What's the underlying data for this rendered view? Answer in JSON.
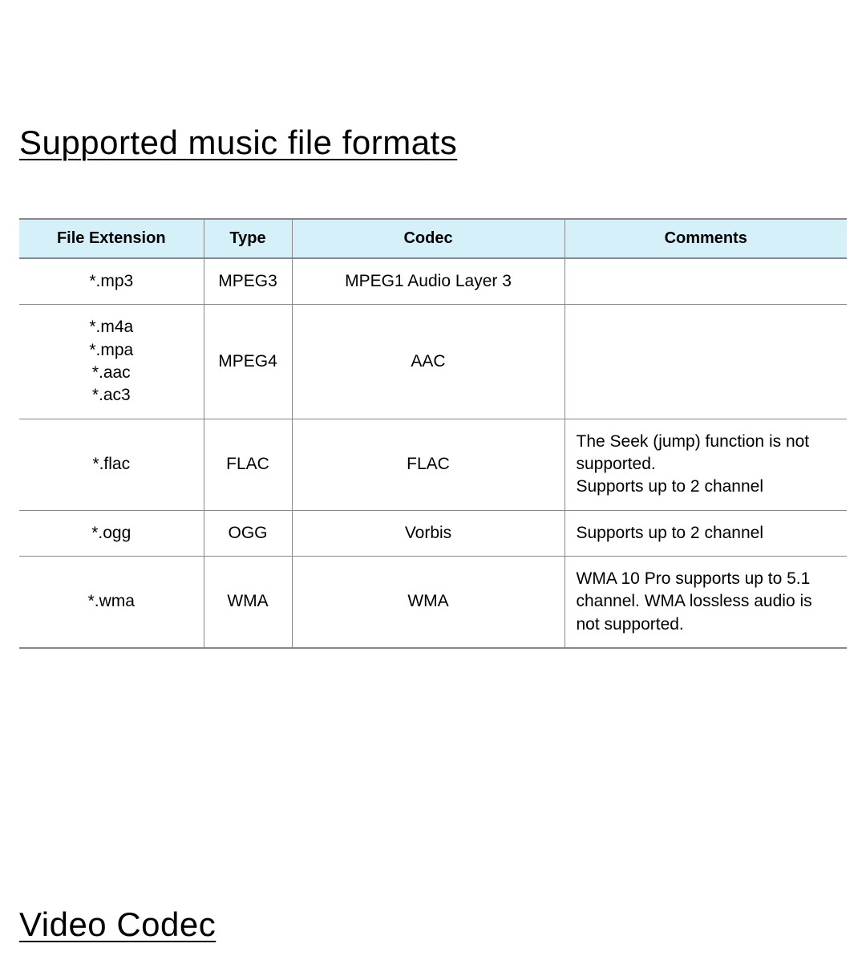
{
  "heading1": "Supported music file formats",
  "heading2": "Video Codec",
  "table": {
    "headers": {
      "ext": "File Extension",
      "type": "Type",
      "codec": "Codec",
      "comments": "Comments"
    },
    "rows": [
      {
        "ext": "*.mp3",
        "type": "MPEG3",
        "codec": "MPEG1 Audio Layer 3",
        "comments": ""
      },
      {
        "ext": "*.m4a\n*.mpa\n*.aac\n*.ac3",
        "type": "MPEG4",
        "codec": "AAC",
        "comments": ""
      },
      {
        "ext": "*.flac",
        "type": "FLAC",
        "codec": "FLAC",
        "comments": "The Seek (jump) function is not supported.\nSupports up to 2 channel"
      },
      {
        "ext": "*.ogg",
        "type": "OGG",
        "codec": "Vorbis",
        "comments": "Supports up to 2 channel"
      },
      {
        "ext": "*.wma",
        "type": "WMA",
        "codec": "WMA",
        "comments": "WMA 10 Pro supports up to 5.1 channel. WMA lossless audio is not supported."
      }
    ]
  }
}
